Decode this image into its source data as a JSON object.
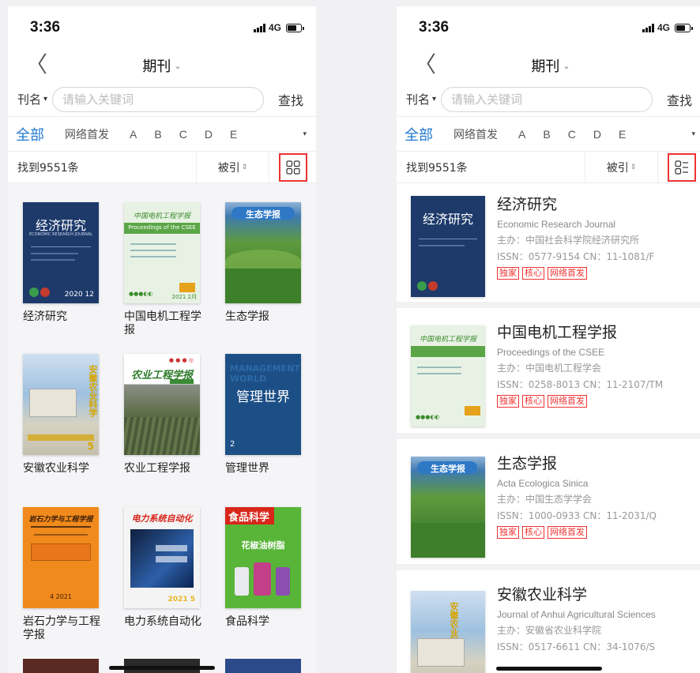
{
  "left": {
    "status": {
      "time": "3:36",
      "network": "4G"
    },
    "nav": {
      "title": "期刊",
      "caret": "⌄",
      "back": "〈"
    },
    "search": {
      "field": "刊名",
      "field_arrow": "▾",
      "placeholder": "请输入关键词",
      "button": "查找"
    },
    "tabs": {
      "items": [
        "全部",
        "网络首发",
        "A",
        "B",
        "C",
        "D",
        "E"
      ],
      "active": "全部",
      "dropdown": "▾"
    },
    "toolbar": {
      "count": "找到9551条",
      "sort": "被引",
      "sort_icon": "⇕",
      "view_icon": "grid-view-icon"
    },
    "grid": [
      {
        "name": "经济研究",
        "cover_title": "经济研究",
        "cover_sub": "ECONOMIC RESEARCH JOURNAL",
        "cover_no": "2020 12",
        "bg": "#1d3a6b"
      },
      {
        "name": "中国电机工程学报",
        "cover_title": "中国电机工程学报",
        "cover_sub": "Proceedings of the CSEE",
        "cover_no": "2021 2月",
        "bg": "#e8f2e4"
      },
      {
        "name": "生态学报",
        "cover_title": "生态学报",
        "cover_sub": "",
        "cover_no": "",
        "bg": "#3c7a2a"
      },
      {
        "name": "安徽农业科学",
        "cover_title": "安徽农业科学",
        "cover_sub": "",
        "cover_no": "5",
        "bg": "#6e95b8"
      },
      {
        "name": "农业工程学报",
        "cover_title": "农业工程学报",
        "cover_sub": "",
        "cover_no": "",
        "bg": "#57704a"
      },
      {
        "name": "管理世界",
        "cover_title": "管理世界",
        "cover_sub": "MANAGEMENT WORLD",
        "cover_no": "2",
        "bg": "#1c4f86"
      },
      {
        "name": "岩石力学与工程学报",
        "cover_title": "岩石力学与工程学报",
        "cover_sub": "",
        "cover_no": "4 2021",
        "bg": "#f08a1c"
      },
      {
        "name": "电力系统自动化",
        "cover_title": "电力系统自动化",
        "cover_sub": "",
        "cover_no": "2021 5",
        "bg": "#f4f4f4"
      },
      {
        "name": "食品科学",
        "cover_title": "食品科学",
        "cover_sub": "花椒油树脂",
        "cover_no": "",
        "bg": "#58b537"
      }
    ]
  },
  "right": {
    "status": {
      "time": "3:36",
      "network": "4G"
    },
    "nav": {
      "title": "期刊",
      "caret": "⌄",
      "back": "〈"
    },
    "search": {
      "field": "刊名",
      "field_arrow": "▾",
      "placeholder": "请输入关键词",
      "button": "查找"
    },
    "tabs": {
      "items": [
        "全部",
        "网络首发",
        "A",
        "B",
        "C",
        "D",
        "E"
      ],
      "active": "全部",
      "dropdown": "▾"
    },
    "toolbar": {
      "count": "找到9551条",
      "sort": "被引",
      "sort_icon": "⇕",
      "view_icon": "list-view-icon"
    },
    "list": [
      {
        "zh": "经济研究",
        "en": "Economic Research Journal",
        "host": "主办：中国社会科学院经济研究所",
        "issn": "ISSN：0577-9154   CN：11-1081/F",
        "tags": [
          "独家",
          "核心",
          "网络首发"
        ],
        "bg": "#1d3a6b"
      },
      {
        "zh": "中国电机工程学报",
        "en": "Proceedings of the CSEE",
        "host": "主办：中国电机工程学会",
        "issn": "ISSN：0258-8013   CN：11-2107/TM",
        "tags": [
          "独家",
          "核心",
          "网络首发"
        ],
        "bg": "#e8f2e4"
      },
      {
        "zh": "生态学报",
        "en": "Acta Ecologica Sinica",
        "host": "主办：中国生态学学会",
        "issn": "ISSN：1000-0933   CN：11-2031/Q",
        "tags": [
          "独家",
          "核心",
          "网络首发"
        ],
        "bg": "#3c7a2a"
      },
      {
        "zh": "安徽农业科学",
        "en": "Journal of Anhui Agricultural Sciences",
        "host": "主办：安徽省农业科学院",
        "issn": "ISSN：0517-6611   CN：34-1076/S",
        "tags": [],
        "bg": "#6e95b8"
      }
    ]
  }
}
